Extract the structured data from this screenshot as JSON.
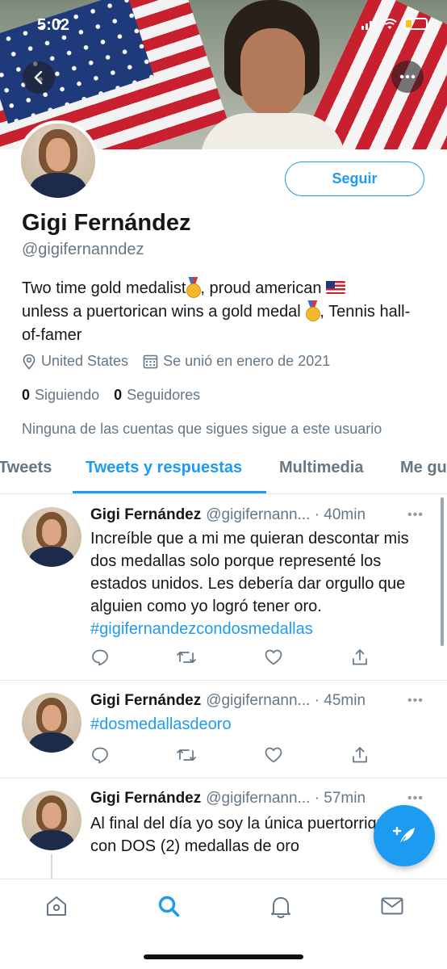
{
  "status_bar": {
    "time": "5:02"
  },
  "header": {
    "back_icon": "chevron-left-icon",
    "more_icon": "more-horizontal-icon"
  },
  "profile": {
    "display_name": "Gigi Fernández",
    "handle": "@gigifernanndez",
    "follow_label": "Seguir",
    "bio": {
      "part1": "Two time gold medalist",
      "part2": ", proud american",
      "part3": "unless a puertorican wins a gold medal",
      "part4": ", Tennis hall-of-famer"
    },
    "location": "United States",
    "joined": "Se unió en enero de 2021",
    "following_count": "0",
    "following_label": "Siguiendo",
    "followers_count": "0",
    "followers_label": "Seguidores",
    "notice": "Ninguna de las cuentas que sigues sigue a este usuario"
  },
  "tabs": [
    {
      "label": "Tweets"
    },
    {
      "label": "Tweets y respuestas",
      "active": true
    },
    {
      "label": "Multimedia"
    },
    {
      "label": "Me gu"
    }
  ],
  "tweets": [
    {
      "name": "Gigi Fernández",
      "handle": "@gigifernann...",
      "time": "· 40min",
      "text": "Increíble que a mi me quieran descontar mis dos medallas solo porque representé los estados unidos. Les debería dar orgullo que alguien como yo logró tener oro.",
      "hashtag": "#gigifernandezcondosmedallas"
    },
    {
      "name": "Gigi Fernández",
      "handle": "@gigifernann...",
      "time": "· 45min",
      "text": "",
      "hashtag": "#dosmedallasdeoro"
    },
    {
      "name": "Gigi Fernández",
      "handle": "@gigifernann...",
      "time": "· 57min",
      "text": "Al final del día yo soy la única puertorriqueña con DOS (2) medallas de oro",
      "hashtag": ""
    }
  ],
  "bottom_nav": [
    {
      "icon": "home-icon"
    },
    {
      "icon": "search-icon",
      "active": true
    },
    {
      "icon": "bell-icon"
    },
    {
      "icon": "mail-icon"
    }
  ],
  "colors": {
    "accent": "#1d9bf0",
    "secondary_text": "#657786",
    "divider": "#e1e8ed"
  }
}
